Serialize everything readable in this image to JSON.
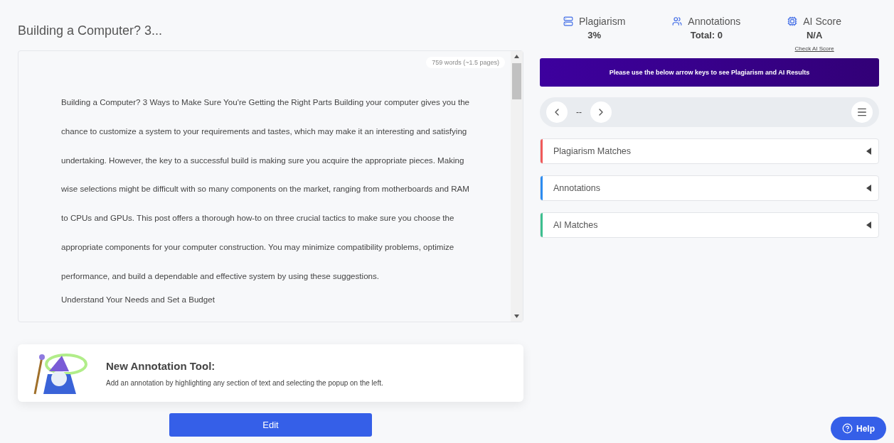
{
  "document": {
    "title": "Building a Computer? 3...",
    "word_count": "759 words (~1.5 pages)",
    "paragraphs": [
      "Building a Computer? 3 Ways to Make Sure You're Getting the Right Parts Building your computer gives you the chance to customize a system to your requirements and tastes, which may make it an interesting and satisfying undertaking. However, the key to a successful build is making sure you acquire the appropriate pieces. Making wise selections might be difficult with so many components on the market, ranging from motherboards and RAM to CPUs and GPUs. This post offers a thorough how-to on three crucial tactics to make sure you choose the appropriate components for your computer construction. You may minimize compatibility problems, optimize performance, and build a dependable and effective system by using these suggestions.",
      "Understand Your Needs and Set a Budget"
    ]
  },
  "annotation_tip": {
    "title": "New Annotation Tool:",
    "text": "Add an annotation by highlighting any section of text and selecting the popup on the left."
  },
  "edit_button": "Edit",
  "stats": [
    {
      "kind": "plagiarism",
      "label": "Plagiarism",
      "value": "3%"
    },
    {
      "kind": "annotations",
      "label": "Annotations",
      "value": "Total: 0"
    },
    {
      "kind": "ai",
      "label": "AI Score",
      "value": "N/A",
      "link": "Check AI Score"
    }
  ],
  "banner": "Please use the below arrow keys to see Plagiarism and AI Results",
  "navigator": {
    "position": "--"
  },
  "sections": [
    {
      "label": "Plagiarism Matches",
      "color": "#f05a5a",
      "expanded": false
    },
    {
      "label": "Annotations",
      "color": "#2d8cf0",
      "expanded": false
    },
    {
      "label": "AI Matches",
      "color": "#3dbf8f",
      "expanded": false
    }
  ],
  "help_button": "Help"
}
